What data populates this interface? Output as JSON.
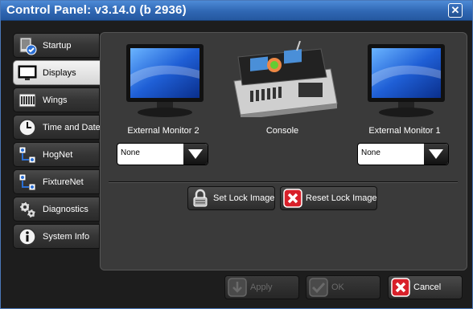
{
  "window": {
    "title": "Control Panel: v3.14.0 (b 2936)",
    "close_glyph": "✕"
  },
  "sidebar": {
    "items": [
      {
        "label": "Startup",
        "icon": "startup-icon",
        "active": false
      },
      {
        "label": "Displays",
        "icon": "monitor-icon",
        "active": true
      },
      {
        "label": "Wings",
        "icon": "wing-icon",
        "active": false
      },
      {
        "label": "Time and Date",
        "icon": "clock-icon",
        "active": false
      },
      {
        "label": "HogNet",
        "icon": "network-icon",
        "active": false
      },
      {
        "label": "FixtureNet",
        "icon": "network-icon",
        "active": false
      },
      {
        "label": "Diagnostics",
        "icon": "gears-icon",
        "active": false
      },
      {
        "label": "System Info",
        "icon": "info-icon",
        "active": false
      }
    ]
  },
  "displays": {
    "external_monitor_2": {
      "label": "External Monitor 2",
      "selected": "None"
    },
    "console": {
      "label": "Console"
    },
    "external_monitor_1": {
      "label": "External Monitor 1",
      "selected": "None"
    },
    "set_lock_image": "Set Lock Image",
    "reset_lock_image": "Reset Lock Image"
  },
  "footer": {
    "apply": "Apply",
    "ok": "OK",
    "cancel": "Cancel"
  },
  "colors": {
    "titlebar": "#3a74c2",
    "cancel_red": "#d8202a",
    "monitor_blue": "#1f5fd6"
  }
}
